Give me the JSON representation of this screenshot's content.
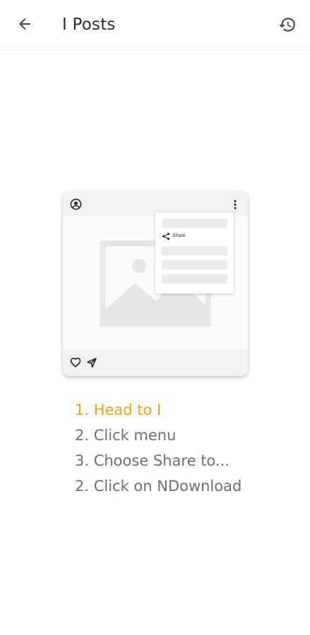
{
  "topbar": {
    "back_icon": "arrow-back-icon",
    "title": "I Posts",
    "history_icon": "history-icon"
  },
  "illustration": {
    "avatar_icon": "account-circle-icon",
    "menu_icon": "more-vert-icon",
    "menu": {
      "share_label": "Share",
      "share_icon": "share-icon"
    },
    "image_icon": "image-placeholder-icon",
    "footer": {
      "like_icon": "heart-icon",
      "send_icon": "send-icon"
    }
  },
  "steps": [
    {
      "text": "1. Head to I",
      "active": true
    },
    {
      "text": "2. Click menu",
      "active": false
    },
    {
      "text": "3. Choose Share to...",
      "active": false
    },
    {
      "text": "2. Click on NDownload",
      "active": false
    }
  ],
  "colors": {
    "accent": "#e8a317",
    "step_text": "#6f6f6f",
    "title_text": "#2b2b2b"
  }
}
